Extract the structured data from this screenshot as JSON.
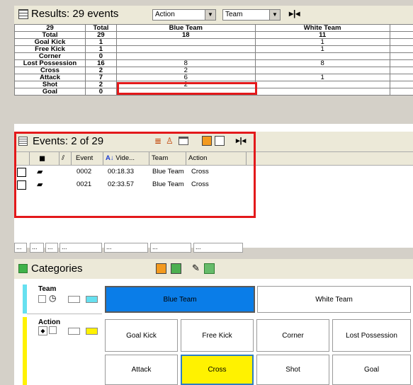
{
  "results": {
    "title": "Results: 29 events",
    "combo1": "Action",
    "combo2": "Team",
    "header_row": [
      "29",
      "Total",
      "Blue Team",
      "White Team"
    ],
    "rows": [
      {
        "label": "Total",
        "total": "29",
        "blue": "18",
        "white": "11"
      },
      {
        "label": "Goal Kick",
        "total": "1",
        "blue": "",
        "white": "1"
      },
      {
        "label": "Free Kick",
        "total": "1",
        "blue": "",
        "white": "1"
      },
      {
        "label": "Corner",
        "total": "0",
        "blue": "",
        "white": ""
      },
      {
        "label": "Lost Possession",
        "total": "16",
        "blue": "8",
        "white": "8"
      },
      {
        "label": "Cross",
        "total": "2",
        "blue": "2",
        "white": ""
      },
      {
        "label": "Attack",
        "total": "7",
        "blue": "6",
        "white": "1"
      },
      {
        "label": "Shot",
        "total": "2",
        "blue": "2",
        "white": ""
      },
      {
        "label": "Goal",
        "total": "0",
        "blue": "",
        "white": ""
      }
    ]
  },
  "events": {
    "title": "Events: 2 of 29",
    "columns": [
      "Event",
      "Vide...",
      "Team",
      "Action"
    ],
    "rows": [
      {
        "event": "0002",
        "video": "00:18.33",
        "team": "Blue Team",
        "action": "Cross"
      },
      {
        "event": "0021",
        "video": "02:33.57",
        "team": "Blue Team",
        "action": "Cross"
      }
    ],
    "footer": [
      "...",
      "...",
      "...",
      "...",
      "...",
      "...",
      "..."
    ]
  },
  "categories": {
    "title": "Categories",
    "team_label": "Team",
    "action_label": "Action",
    "team_buttons": [
      "Blue Team",
      "White Team"
    ],
    "action_buttons_row1": [
      "Goal Kick",
      "Free Kick",
      "Corner",
      "Lost Possession"
    ],
    "action_buttons_row2": [
      "Attack",
      "Cross",
      "Shot",
      "Goal"
    ]
  },
  "colors": {
    "blue_team": "#0a7de8",
    "cross_selected": "#fff200",
    "team_accent": "#66e0f0",
    "action_accent": "#fff200",
    "highlight_border": "#e3191b"
  },
  "icons": [
    "table-icon",
    "dropdown-arrow-icon",
    "split-icon",
    "list-icon",
    "stack-icon",
    "players-icon",
    "window-icon",
    "orange-grid-icon",
    "white-grid-icon",
    "camera-icon",
    "paperclip-icon",
    "sort-az-icon",
    "timer-icon",
    "checkbox-icon"
  ]
}
